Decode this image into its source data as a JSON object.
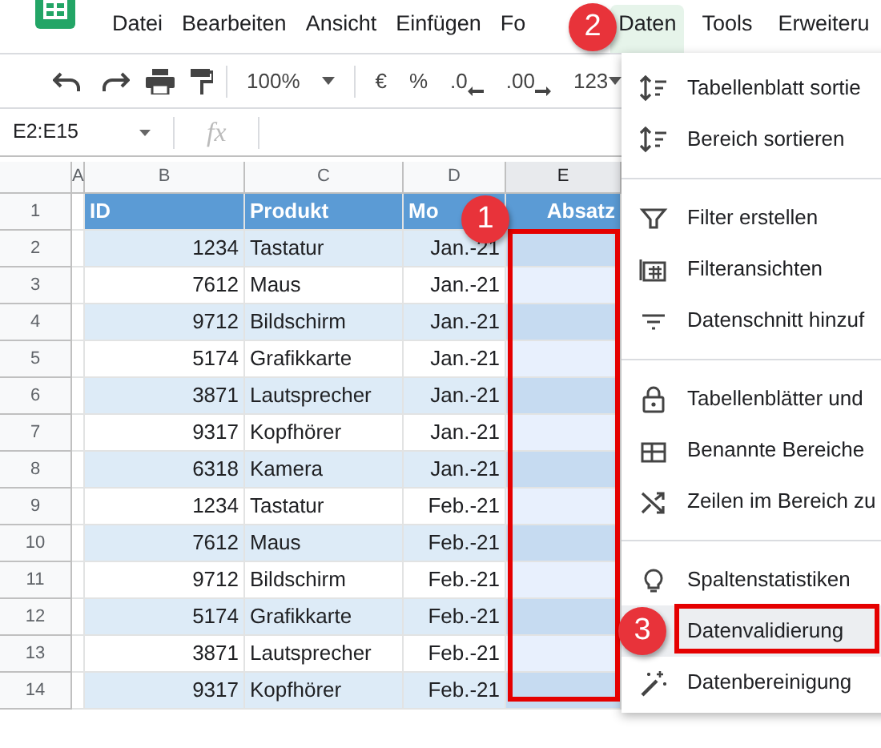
{
  "menubar": {
    "items": [
      {
        "label": "Datei",
        "selected": false
      },
      {
        "label": "Bearbeiten",
        "selected": false
      },
      {
        "label": "Ansicht",
        "selected": false
      },
      {
        "label": "Einfügen",
        "selected": false
      },
      {
        "label": "Fo",
        "selected": false
      },
      {
        "label": "Daten",
        "selected": true
      },
      {
        "label": "Tools",
        "selected": false
      },
      {
        "label": "Erweiteru",
        "selected": false
      }
    ]
  },
  "toolbar": {
    "zoom": "100%",
    "buttons": [
      "€",
      "%",
      ".0",
      ".00",
      "123"
    ]
  },
  "formula_bar": {
    "name_box": "E2:E15",
    "fx": "fx"
  },
  "sheet": {
    "columns": [
      {
        "label": "A",
        "selected": false
      },
      {
        "label": "B",
        "selected": false
      },
      {
        "label": "C",
        "selected": false
      },
      {
        "label": "D",
        "selected": false
      },
      {
        "label": "E",
        "selected": true
      }
    ],
    "header": {
      "number": "1",
      "cells": [
        "",
        "ID",
        "Produkt",
        "Mo",
        "Absatz"
      ]
    },
    "rows": [
      {
        "number": "2",
        "cells": [
          "",
          "1234",
          "Tastatur",
          "Jan.-21",
          ""
        ]
      },
      {
        "number": "3",
        "cells": [
          "",
          "7612",
          "Maus",
          "Jan.-21",
          ""
        ]
      },
      {
        "number": "4",
        "cells": [
          "",
          "9712",
          "Bildschirm",
          "Jan.-21",
          ""
        ]
      },
      {
        "number": "5",
        "cells": [
          "",
          "5174",
          "Grafikkarte",
          "Jan.-21",
          ""
        ]
      },
      {
        "number": "6",
        "cells": [
          "",
          "3871",
          "Lautsprecher",
          "Jan.-21",
          ""
        ]
      },
      {
        "number": "7",
        "cells": [
          "",
          "9317",
          "Kopfhörer",
          "Jan.-21",
          ""
        ]
      },
      {
        "number": "8",
        "cells": [
          "",
          "6318",
          "Kamera",
          "Jan.-21",
          ""
        ]
      },
      {
        "number": "9",
        "cells": [
          "",
          "1234",
          "Tastatur",
          "Feb.-21",
          ""
        ]
      },
      {
        "number": "10",
        "cells": [
          "",
          "7612",
          "Maus",
          "Feb.-21",
          ""
        ]
      },
      {
        "number": "11",
        "cells": [
          "",
          "9712",
          "Bildschirm",
          "Feb.-21",
          ""
        ]
      },
      {
        "number": "12",
        "cells": [
          "",
          "5174",
          "Grafikkarte",
          "Feb.-21",
          ""
        ]
      },
      {
        "number": "13",
        "cells": [
          "",
          "3871",
          "Lautsprecher",
          "Feb.-21",
          ""
        ]
      },
      {
        "number": "14",
        "cells": [
          "",
          "9317",
          "Kopfhörer",
          "Feb.-21",
          ""
        ]
      }
    ]
  },
  "dropdown": {
    "items": [
      {
        "kind": "item",
        "label": "Tabellenblatt sortie",
        "highlighted": false
      },
      {
        "kind": "item",
        "label": "Bereich sortieren",
        "highlighted": false
      },
      {
        "kind": "divider"
      },
      {
        "kind": "item",
        "label": "Filter erstellen",
        "highlighted": false
      },
      {
        "kind": "item",
        "label": "Filteransichten",
        "highlighted": false
      },
      {
        "kind": "item",
        "label": "Datenschnitt hinzuf",
        "highlighted": false
      },
      {
        "kind": "divider"
      },
      {
        "kind": "item",
        "label": "Tabellenblätter und",
        "highlighted": false
      },
      {
        "kind": "item",
        "label": "Benannte Bereiche",
        "highlighted": false
      },
      {
        "kind": "item",
        "label": "Zeilen im Bereich zu",
        "highlighted": false
      },
      {
        "kind": "divider"
      },
      {
        "kind": "item",
        "label": "Spaltenstatistiken",
        "highlighted": false
      },
      {
        "kind": "item",
        "label": "Datenvalidierung",
        "highlighted": true
      },
      {
        "kind": "item",
        "label": "Datenbereinigung",
        "highlighted": false
      }
    ]
  },
  "callouts": [
    {
      "number": "1"
    },
    {
      "number": "2"
    },
    {
      "number": "3"
    }
  ]
}
